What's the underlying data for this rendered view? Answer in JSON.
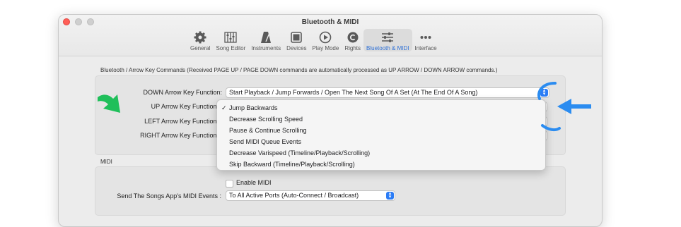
{
  "window": {
    "title": "Bluetooth & MIDI",
    "colors": {
      "close": "#ff5f57",
      "minimize": "#c8c8c8",
      "zoom": "#c8c8c8",
      "accent": "#2b7cf6"
    }
  },
  "toolbar": {
    "items": [
      {
        "label": "General",
        "icon": "gear-icon"
      },
      {
        "label": "Song Editor",
        "icon": "sliders-grid-icon"
      },
      {
        "label": "Instruments",
        "icon": "metronome-icon"
      },
      {
        "label": "Devices",
        "icon": "device-icon"
      },
      {
        "label": "Play Mode",
        "icon": "play-circle-icon"
      },
      {
        "label": "Rights",
        "icon": "copyright-icon"
      },
      {
        "label": "Bluetooth & MIDI",
        "icon": "sliders-icon",
        "active": true
      },
      {
        "label": "Interface",
        "icon": "ellipsis-icon"
      }
    ]
  },
  "bluetooth": {
    "section_label": "Bluetooth / Arrow Key Commands (Received PAGE UP / PAGE DOWN commands are automatically processed as UP ARROW / DOWN ARROW commands.)",
    "down_label": "DOWN Arrow Key Function:",
    "down_value": "Start Playback / Jump Forwards / Open The Next Song Of A Set (At The End Of A Song)",
    "up_label": "UP Arrow Key Function:",
    "left_label": "LEFT Arrow Key Function:",
    "right_label": "RIGHT Arrow Key Function:"
  },
  "menu": {
    "items": [
      {
        "label": "Jump Backwards",
        "checked": true
      },
      {
        "label": "Decrease Scrolling Speed"
      },
      {
        "label": "Pause & Continue Scrolling"
      },
      {
        "label": "Send MIDI Queue Events"
      },
      {
        "label": "Decrease Varispeed (Timeline/Playback/Scrolling)"
      },
      {
        "label": "Skip Backward (Timeline/Playback/Scrolling)"
      }
    ]
  },
  "midi": {
    "section_label": "MIDI",
    "enable_label": "Enable MIDI",
    "enabled": false,
    "send_label": "Send The Songs App's MIDI Events :",
    "send_value": "To All Active Ports (Auto-Connect / Broadcast)"
  },
  "annotations": {
    "green_arrow_color": "#1fbf5a",
    "blue_arrow_color": "#2b8cf0"
  }
}
